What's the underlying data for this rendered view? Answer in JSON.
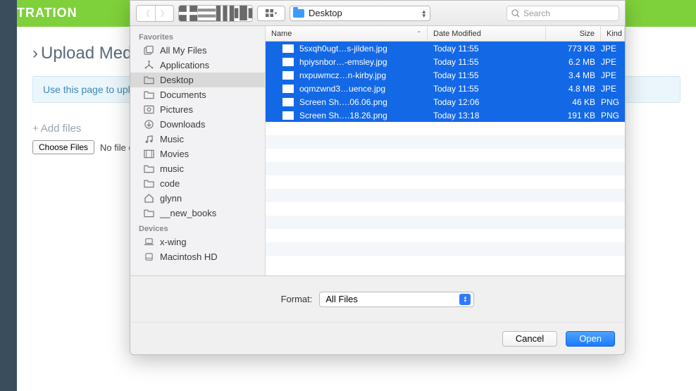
{
  "background": {
    "topbar_text": "TRATION",
    "breadcrumb": "Upload Med",
    "info_text": "Use this page to uplo",
    "add_files_label": "Add files",
    "choose_files_label": "Choose Files",
    "no_file_text": "No file ch"
  },
  "dialog": {
    "location": "Desktop",
    "search_placeholder": "Search",
    "sidebar": {
      "favorites_label": "Favorites",
      "devices_label": "Devices",
      "favorites": [
        {
          "label": "All My Files",
          "icon": "all-files"
        },
        {
          "label": "Applications",
          "icon": "apps"
        },
        {
          "label": "Desktop",
          "icon": "folder",
          "selected": true
        },
        {
          "label": "Documents",
          "icon": "folder"
        },
        {
          "label": "Pictures",
          "icon": "pictures"
        },
        {
          "label": "Downloads",
          "icon": "downloads"
        },
        {
          "label": "Music",
          "icon": "music"
        },
        {
          "label": "Movies",
          "icon": "movies"
        },
        {
          "label": "music",
          "icon": "folder"
        },
        {
          "label": "code",
          "icon": "folder"
        },
        {
          "label": "glynn",
          "icon": "home"
        },
        {
          "label": "__new_books",
          "icon": "folder"
        }
      ],
      "devices": [
        {
          "label": "x-wing",
          "icon": "laptop"
        },
        {
          "label": "Macintosh HD",
          "icon": "disk"
        }
      ]
    },
    "columns": {
      "name": "Name",
      "date": "Date Modified",
      "size": "Size",
      "kind": "Kind"
    },
    "files": [
      {
        "name": "5sxqh0ugt…s-jilden.jpg",
        "date": "Today 11:55",
        "size": "773 KB",
        "kind": "JPE",
        "selected": true
      },
      {
        "name": "hpiysnbor…-emsley.jpg",
        "date": "Today 11:55",
        "size": "6.2 MB",
        "kind": "JPE",
        "selected": true
      },
      {
        "name": "nxpuwmcz…n-kirby.jpg",
        "date": "Today 11:55",
        "size": "3.4 MB",
        "kind": "JPE",
        "selected": true
      },
      {
        "name": "oqmzwnd3…uence.jpg",
        "date": "Today 11:55",
        "size": "4.8 MB",
        "kind": "JPE",
        "selected": true
      },
      {
        "name": "Screen Sh….06.06.png",
        "date": "Today 12:06",
        "size": "46 KB",
        "kind": "PNG",
        "selected": true
      },
      {
        "name": "Screen Sh….18.26.png",
        "date": "Today 13:18",
        "size": "191 KB",
        "kind": "PNG",
        "selected": true
      }
    ],
    "format_label": "Format:",
    "format_value": "All Files",
    "cancel_label": "Cancel",
    "open_label": "Open"
  }
}
